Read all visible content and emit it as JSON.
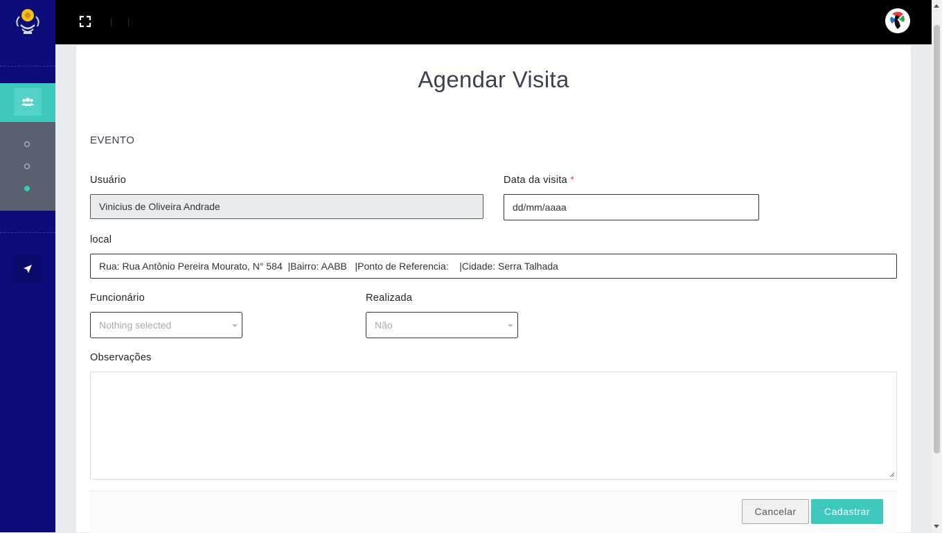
{
  "page": {
    "title": "Agendar Visita",
    "section": "EVENTO"
  },
  "form": {
    "usuario": {
      "label": "Usuário",
      "value": "Vinicius de Oliveira Andrade"
    },
    "data_visita": {
      "label": "Data da visita",
      "required_mark": "*",
      "value": "dd/mm/aaaa"
    },
    "local": {
      "label": "local",
      "value": "Rua: Rua Antônio Pereira Mourato, N° 584  |Bairro: AABB   |Ponto de Referencia:    |Cidade: Serra Talhada"
    },
    "funcionario": {
      "label": "Funcionário",
      "value": "Nothing selected"
    },
    "realizada": {
      "label": "Realizada",
      "value": "Não"
    },
    "observacoes": {
      "label": "Observações",
      "value": ""
    }
  },
  "buttons": {
    "cancel": "Cancelar",
    "save": "Cadastrar"
  },
  "sidebar": {
    "items": [
      {
        "icon": "users-icon",
        "active": true
      },
      {
        "icon": "location-arrow-icon",
        "active": false
      }
    ],
    "subitems": [
      {
        "active": false
      },
      {
        "active": false
      },
      {
        "active": true
      }
    ]
  },
  "colors": {
    "sidebar_bg": "#0c0c7a",
    "accent": "#3dc9bd",
    "topbar_bg": "#000000"
  }
}
